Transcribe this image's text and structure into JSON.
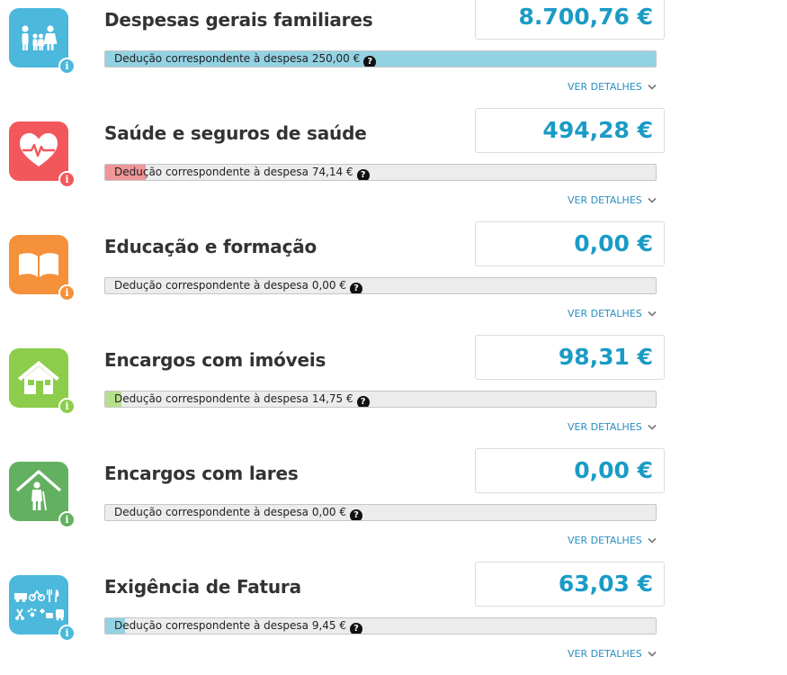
{
  "details_label": "VER DETALHES",
  "help_icon_glyph": "?",
  "info_icon_glyph": "i",
  "items": [
    {
      "icon": "family-icon",
      "color": "#4bb8dc",
      "title": "Despesas gerais familiares",
      "amount": "8.700,76 €",
      "deduction_text": "Dedução correspondente à despesa 250,00 €",
      "progress": 1.0,
      "progress_color": "#93d2e2"
    },
    {
      "icon": "heart-pulse-icon",
      "color": "#f2575c",
      "title": "Saúde e seguros de saúde",
      "amount": "494,28 €",
      "deduction_text": "Dedução correspondente à despesa 74,14 €",
      "progress": 0.074,
      "progress_color": "#f09598"
    },
    {
      "icon": "book-icon",
      "color": "#f5913a",
      "title": "Educação e formação",
      "amount": "0,00 €",
      "deduction_text": "Dedução correspondente à despesa 0,00 €",
      "progress": 0.0,
      "progress_color": "#f5b57c"
    },
    {
      "icon": "house-icon",
      "color": "#8ccd4b",
      "title": "Encargos com imóveis",
      "amount": "98,31 €",
      "deduction_text": "Dedução correspondente à despesa 14,75 €",
      "progress": 0.029,
      "progress_color": "#b7e08d"
    },
    {
      "icon": "elderly-home-icon",
      "color": "#63b060",
      "title": "Encargos com lares",
      "amount": "0,00 €",
      "deduction_text": "Dedução correspondente à despesa 0,00 €",
      "progress": 0.0,
      "progress_color": "#a2d49f"
    },
    {
      "icon": "invoice-sectors-icon",
      "color": "#4bb8dc",
      "title": "Exigência de Fatura",
      "amount": "63,03 €",
      "deduction_text": "Dedução correspondente à despesa 9,45 €",
      "progress": 0.036,
      "progress_color": "#93d2e2"
    }
  ]
}
